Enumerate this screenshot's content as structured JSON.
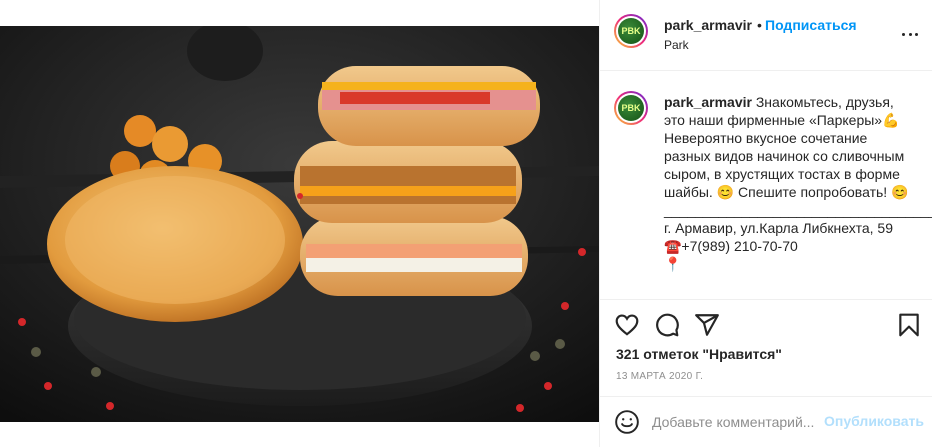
{
  "post": {
    "header": {
      "username": "park_armavir",
      "separator": "•",
      "follow_label": "Подписаться",
      "location": "Park",
      "avatar_text": "PBK"
    },
    "caption": {
      "username": "park_armavir",
      "line1": "Знакомьтесь, друзья, это наши фирменные «Паркеры»💪",
      "line2": "Невероятно вкусное сочетание разных видов начинок со сливочным сыром, в хрустящих тостах в форме шайбы. 😊 Спешите попробовать! 😊",
      "rule": "______________________________________",
      "address": "г. Армавир, ул.Карла Либкнехта, 59",
      "phone": "☎️+7(989) 210-70-70",
      "next": "📍"
    },
    "icons": {
      "like": "heart-icon",
      "comment": "comment-icon",
      "share": "share-icon",
      "save": "bookmark-icon",
      "more": "more-icon",
      "emoji": "smile-icon"
    },
    "likes": "321 отметок \"Нравится\"",
    "date": "13 МАРТА 2020 Г.",
    "comment": {
      "placeholder": "Добавьте комментарий...",
      "value": "",
      "publish_label": "Опубликовать"
    },
    "colors": {
      "accent": "#0095f6",
      "publish_disabled": "#b2dffc",
      "muted": "#8e8e8e",
      "text": "#262626",
      "border": "#efefef"
    }
  }
}
